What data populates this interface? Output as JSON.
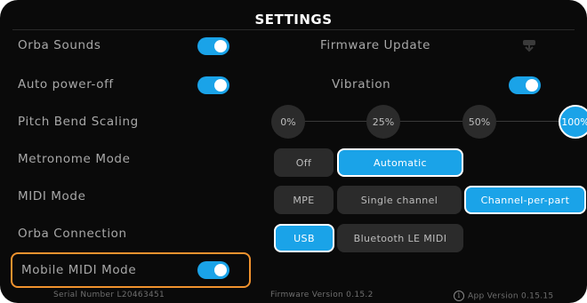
{
  "header": {
    "title": "SETTINGS"
  },
  "colors": {
    "accent": "#1aa3e8",
    "highlight": "#f0922e",
    "background": "#0a0a0a",
    "control_bg": "#2b2b2b"
  },
  "settings": {
    "orba_sounds": {
      "label": "Orba Sounds",
      "toggle_on": true
    },
    "firmware_update": {
      "label": "Firmware Update",
      "icon": "download-icon"
    },
    "auto_power_off": {
      "label": "Auto power-off",
      "toggle_on": true
    },
    "vibration": {
      "label": "Vibration",
      "toggle_on": true
    },
    "pitch_bend_scaling": {
      "label": "Pitch Bend Scaling",
      "options": [
        "0%",
        "25%",
        "50%",
        "100%"
      ],
      "selected": "100%"
    },
    "metronome_mode": {
      "label": "Metronome Mode",
      "options": [
        "Off",
        "Automatic"
      ],
      "selected": "Automatic"
    },
    "midi_mode": {
      "label": "MIDI Mode",
      "options": [
        "MPE",
        "Single channel",
        "Channel-per-part"
      ],
      "selected": "Channel-per-part"
    },
    "orba_connection": {
      "label": "Orba Connection",
      "options": [
        "USB",
        "Bluetooth LE MIDI"
      ],
      "selected": "USB"
    },
    "mobile_midi_mode": {
      "label": "Mobile MIDI Mode",
      "toggle_on": true
    }
  },
  "footer": {
    "serial": "Serial Number L20463451",
    "firmware_version": "Firmware Version 0.15.2",
    "app_version": "App Version 0.15.15",
    "info_icon": "info-icon"
  }
}
